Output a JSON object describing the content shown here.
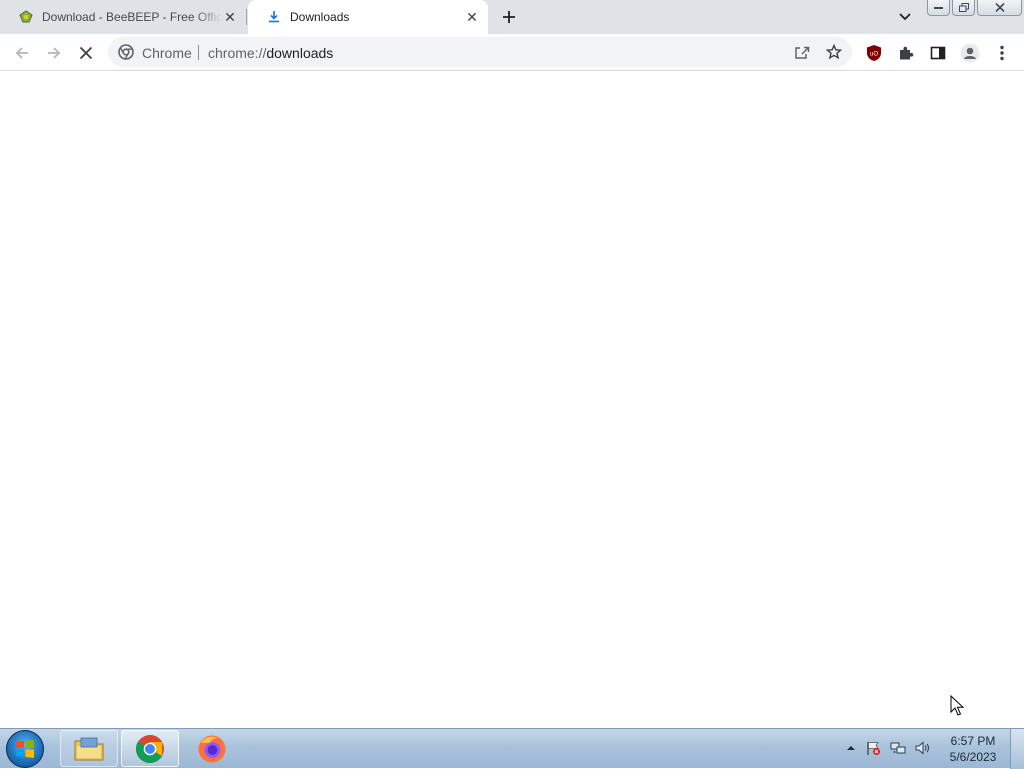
{
  "tabs": [
    {
      "title": "Download - BeeBEEP - Free Office Messenger",
      "active": false,
      "favicon": "beebeep-favicon-icon"
    },
    {
      "title": "Downloads",
      "active": true,
      "favicon": "download-favicon-icon"
    }
  ],
  "omnibox": {
    "site_label": "Chrome",
    "url_scheme": "chrome://",
    "url_path": "downloads"
  },
  "taskbar": {
    "pinned_apps": [
      "windows-explorer",
      "google-chrome",
      "mozilla-firefox"
    ],
    "active_app": "google-chrome"
  },
  "clock": {
    "time": "6:57 PM",
    "date": "5/6/2023"
  },
  "colors": {
    "tabstrip_bg": "#dfe3e8",
    "toolbar_bg": "#ffffff",
    "taskbar_bg": "#aac3dc"
  }
}
